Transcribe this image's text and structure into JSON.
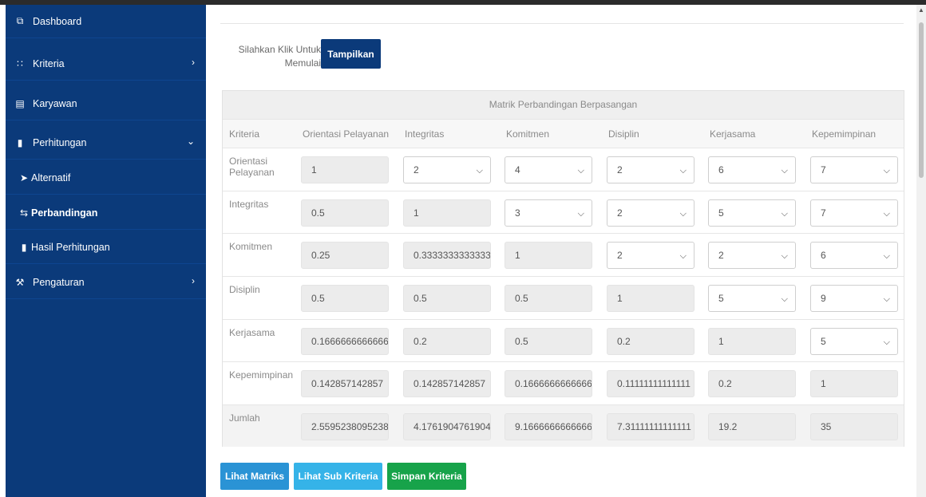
{
  "sidebar": {
    "items": [
      {
        "label": "Dashboard",
        "icon": "tachometer-icon"
      },
      {
        "label": "Kriteria",
        "icon": "grid-icon"
      },
      {
        "label": "Karyawan",
        "icon": "list-icon"
      },
      {
        "label": "Perhitungan",
        "icon": "book-icon"
      },
      {
        "label": "Alternatif",
        "icon": "send-icon"
      },
      {
        "label": "Perbandingan",
        "icon": "exchange-icon"
      },
      {
        "label": "Hasil Perhitungan",
        "icon": "bar-chart-icon"
      },
      {
        "label": "Pengaturan",
        "icon": "tools-icon"
      }
    ]
  },
  "intro": {
    "line1": "Silahkan Klik Untuk",
    "line2": "Memulai"
  },
  "show_button": "Tampilkan",
  "matrix": {
    "title": "Matrik Perbandingan Berpasangan",
    "headers": [
      "Kriteria",
      "Orientasi Pelayanan",
      "Integritas",
      "Komitmen",
      "Disiplin",
      "Kerjasama",
      "Kepemimpinan"
    ],
    "rows": [
      {
        "label": "Orientasi Pelayanan",
        "cells": [
          {
            "v": "1",
            "t": "ro"
          },
          {
            "v": "2",
            "t": "sel"
          },
          {
            "v": "4",
            "t": "sel"
          },
          {
            "v": "2",
            "t": "sel"
          },
          {
            "v": "6",
            "t": "sel"
          },
          {
            "v": "7",
            "t": "sel"
          }
        ]
      },
      {
        "label": "Integritas",
        "cells": [
          {
            "v": "0.5",
            "t": "ro"
          },
          {
            "v": "1",
            "t": "ro"
          },
          {
            "v": "3",
            "t": "sel"
          },
          {
            "v": "2",
            "t": "sel"
          },
          {
            "v": "5",
            "t": "sel"
          },
          {
            "v": "7",
            "t": "sel"
          }
        ]
      },
      {
        "label": "Komitmen",
        "cells": [
          {
            "v": "0.25",
            "t": "ro"
          },
          {
            "v": "0.3333333333333",
            "t": "ro"
          },
          {
            "v": "1",
            "t": "ro"
          },
          {
            "v": "2",
            "t": "sel"
          },
          {
            "v": "2",
            "t": "sel"
          },
          {
            "v": "6",
            "t": "sel"
          }
        ]
      },
      {
        "label": "Disiplin",
        "cells": [
          {
            "v": "0.5",
            "t": "ro"
          },
          {
            "v": "0.5",
            "t": "ro"
          },
          {
            "v": "0.5",
            "t": "ro"
          },
          {
            "v": "1",
            "t": "ro"
          },
          {
            "v": "5",
            "t": "sel"
          },
          {
            "v": "9",
            "t": "sel"
          }
        ]
      },
      {
        "label": "Kerjasama",
        "cells": [
          {
            "v": "0.1666666666666",
            "t": "ro"
          },
          {
            "v": "0.2",
            "t": "ro"
          },
          {
            "v": "0.5",
            "t": "ro"
          },
          {
            "v": "0.2",
            "t": "ro"
          },
          {
            "v": "1",
            "t": "ro"
          },
          {
            "v": "5",
            "t": "sel"
          }
        ]
      },
      {
        "label": "Kepemimpinan",
        "cells": [
          {
            "v": "0.142857142857",
            "t": "ro"
          },
          {
            "v": "0.142857142857",
            "t": "ro"
          },
          {
            "v": "0.1666666666666",
            "t": "ro"
          },
          {
            "v": "0.11111111111111",
            "t": "ro"
          },
          {
            "v": "0.2",
            "t": "ro"
          },
          {
            "v": "1",
            "t": "ro"
          }
        ]
      },
      {
        "label": "Jumlah",
        "cells": [
          {
            "v": "2.5595238095238",
            "t": "ro"
          },
          {
            "v": "4.1761904761904",
            "t": "ro"
          },
          {
            "v": "9.1666666666666",
            "t": "ro"
          },
          {
            "v": "7.31111111111111",
            "t": "ro"
          },
          {
            "v": "19.2",
            "t": "ro"
          },
          {
            "v": "35",
            "t": "ro"
          }
        ]
      }
    ]
  },
  "actions": {
    "view_matrix": "Lihat Matriks",
    "view_sub": "Lihat Sub Kriteria",
    "save": "Simpan Kriteria"
  },
  "colors": {
    "sidebar": "#0b3a7a",
    "primary_dark": "#0b3a7a",
    "info": "#2a93d5",
    "info_light": "#35b3e8",
    "success": "#17a34a"
  }
}
